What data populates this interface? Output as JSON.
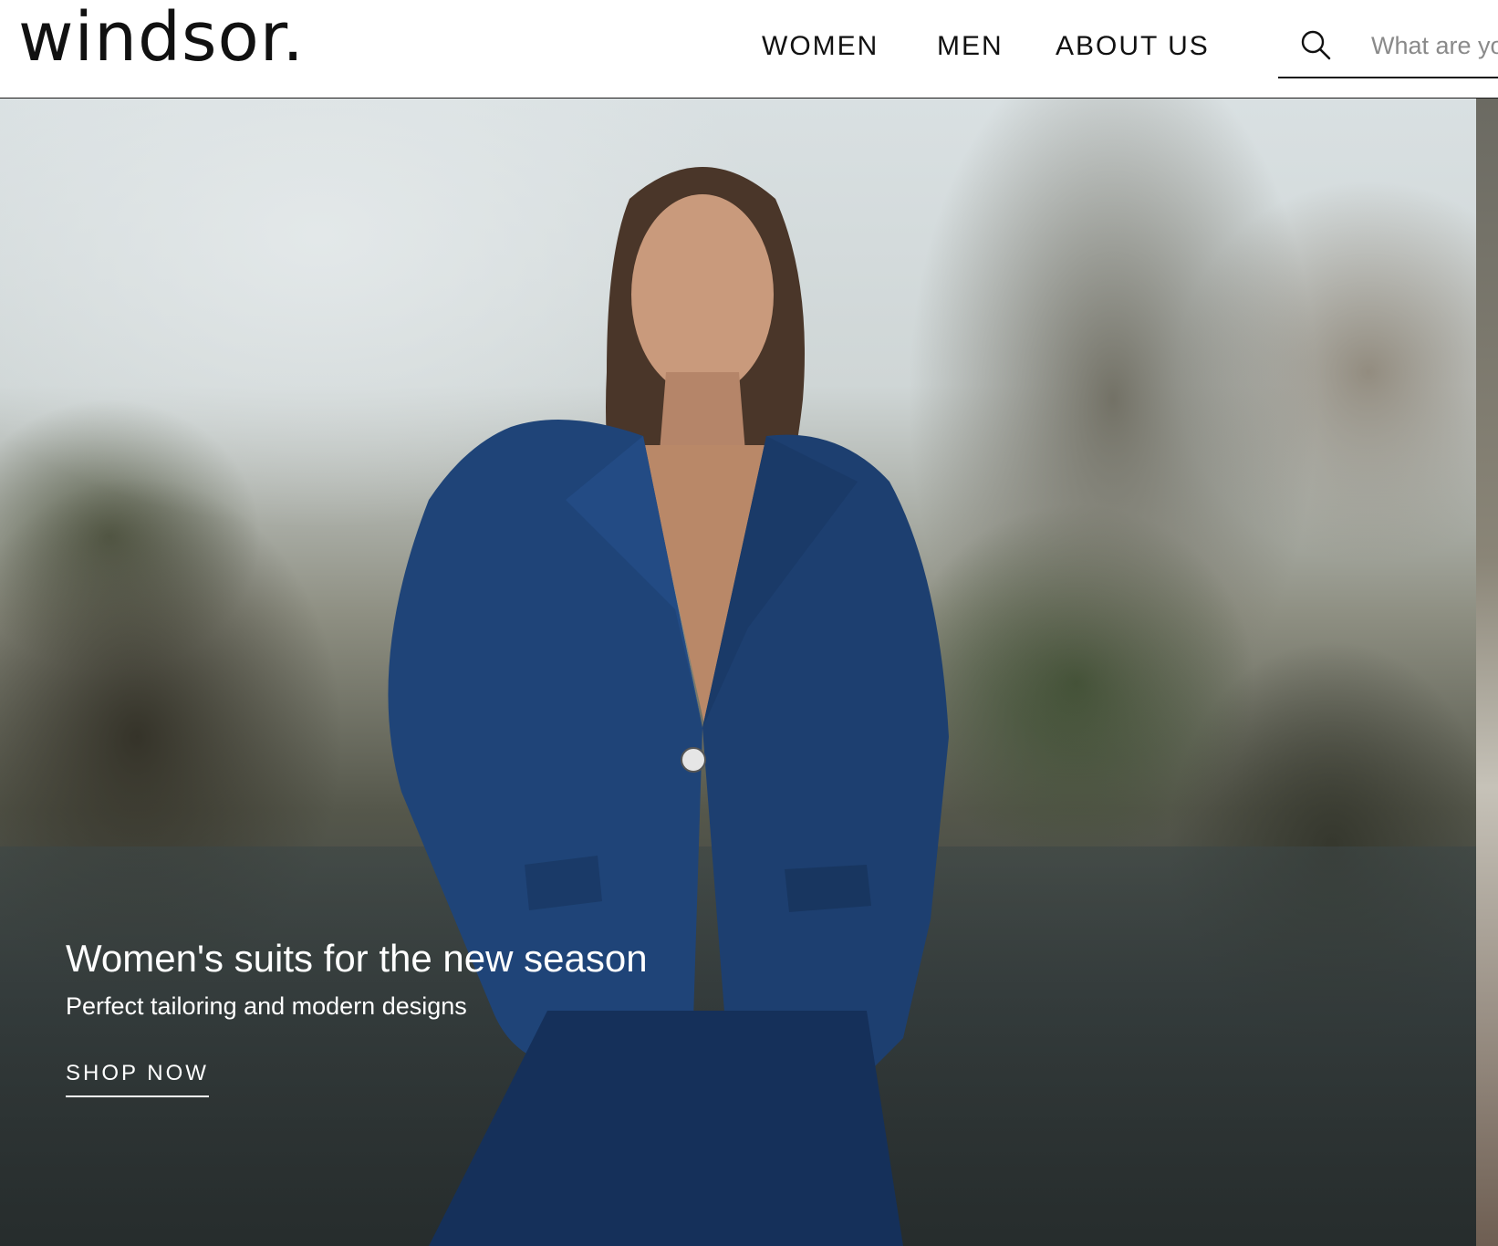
{
  "header": {
    "logo": "windsor.",
    "nav": [
      {
        "label": "WOMEN"
      },
      {
        "label": "MEN"
      },
      {
        "label": "ABOUT US"
      }
    ],
    "search": {
      "placeholder": "What are you looking for?",
      "value": "",
      "icon": "search-icon"
    }
  },
  "hero": {
    "title": "Women's suits for the new season",
    "subtitle": "Perfect tailoring and modern designs",
    "cta_label": "SHOP NOW"
  },
  "colors": {
    "text": "#111111",
    "background": "#ffffff",
    "suit_blue": "#1f4478",
    "hero_text": "#ffffff"
  }
}
